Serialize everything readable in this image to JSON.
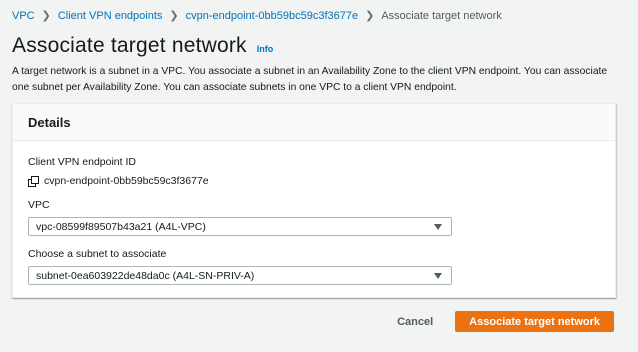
{
  "breadcrumb": {
    "items": [
      "VPC",
      "Client VPN endpoints",
      "cvpn-endpoint-0bb59bc59c3f3677e"
    ],
    "current": "Associate target network"
  },
  "page": {
    "title": "Associate target network",
    "info": "Info",
    "description": "A target network is a subnet in a VPC. You associate a subnet in an Availability Zone to the client VPN endpoint. You can associate one subnet per Availability Zone. You can associate subnets in one VPC to a client VPN endpoint."
  },
  "details": {
    "title": "Details",
    "endpoint_label": "Client VPN endpoint ID",
    "endpoint_id": "cvpn-endpoint-0bb59bc59c3f3677e",
    "vpc_label": "VPC",
    "vpc_value": "vpc-08599f89507b43a21 (A4L-VPC)",
    "subnet_label": "Choose a subnet to associate",
    "subnet_value": "subnet-0ea603922de48da0c (A4L-SN-PRIV-A)"
  },
  "actions": {
    "cancel": "Cancel",
    "submit": "Associate target network"
  },
  "colors": {
    "link": "#0073bb",
    "primary": "#ec7211",
    "background": "#f2f3f3"
  }
}
